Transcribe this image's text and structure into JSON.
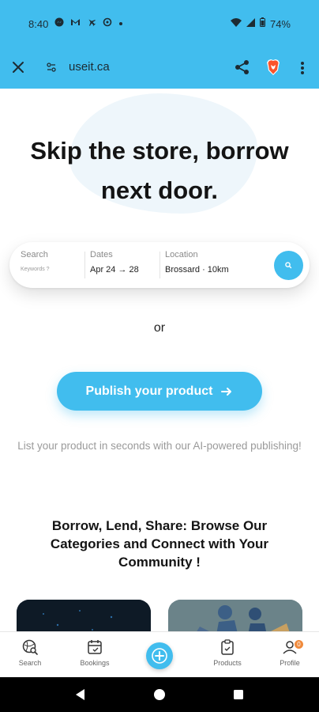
{
  "status_bar": {
    "time": "8:40",
    "battery": "74%"
  },
  "browser": {
    "url": "useit.ca"
  },
  "hero": {
    "title_line1": "Skip the store, borrow",
    "title_line2": "next door."
  },
  "search": {
    "search_label": "Search",
    "search_placeholder": "Keywords ?",
    "dates_label": "Dates",
    "dates_value": "Apr 24 → 28",
    "location_label": "Location",
    "location_value": "Brossard · 10km"
  },
  "or_text": "or",
  "publish": {
    "button_label": "Publish your product",
    "subtitle": "List your product in seconds with our AI-powered publishing!"
  },
  "categories": {
    "title": "Borrow, Lend, Share: Browse Our Categories and Connect with Your Community !"
  },
  "bottom_nav": {
    "items": [
      {
        "label": "Search",
        "icon": "search-globe-icon"
      },
      {
        "label": "Bookings",
        "icon": "calendar-icon"
      },
      {
        "label": "",
        "icon": "plus-icon"
      },
      {
        "label": "Products",
        "icon": "clipboard-check-icon"
      },
      {
        "label": "Profile",
        "icon": "user-icon"
      }
    ],
    "profile_badge": "0"
  },
  "colors": {
    "brand": "#41bdee",
    "badge": "#f08a3c"
  }
}
